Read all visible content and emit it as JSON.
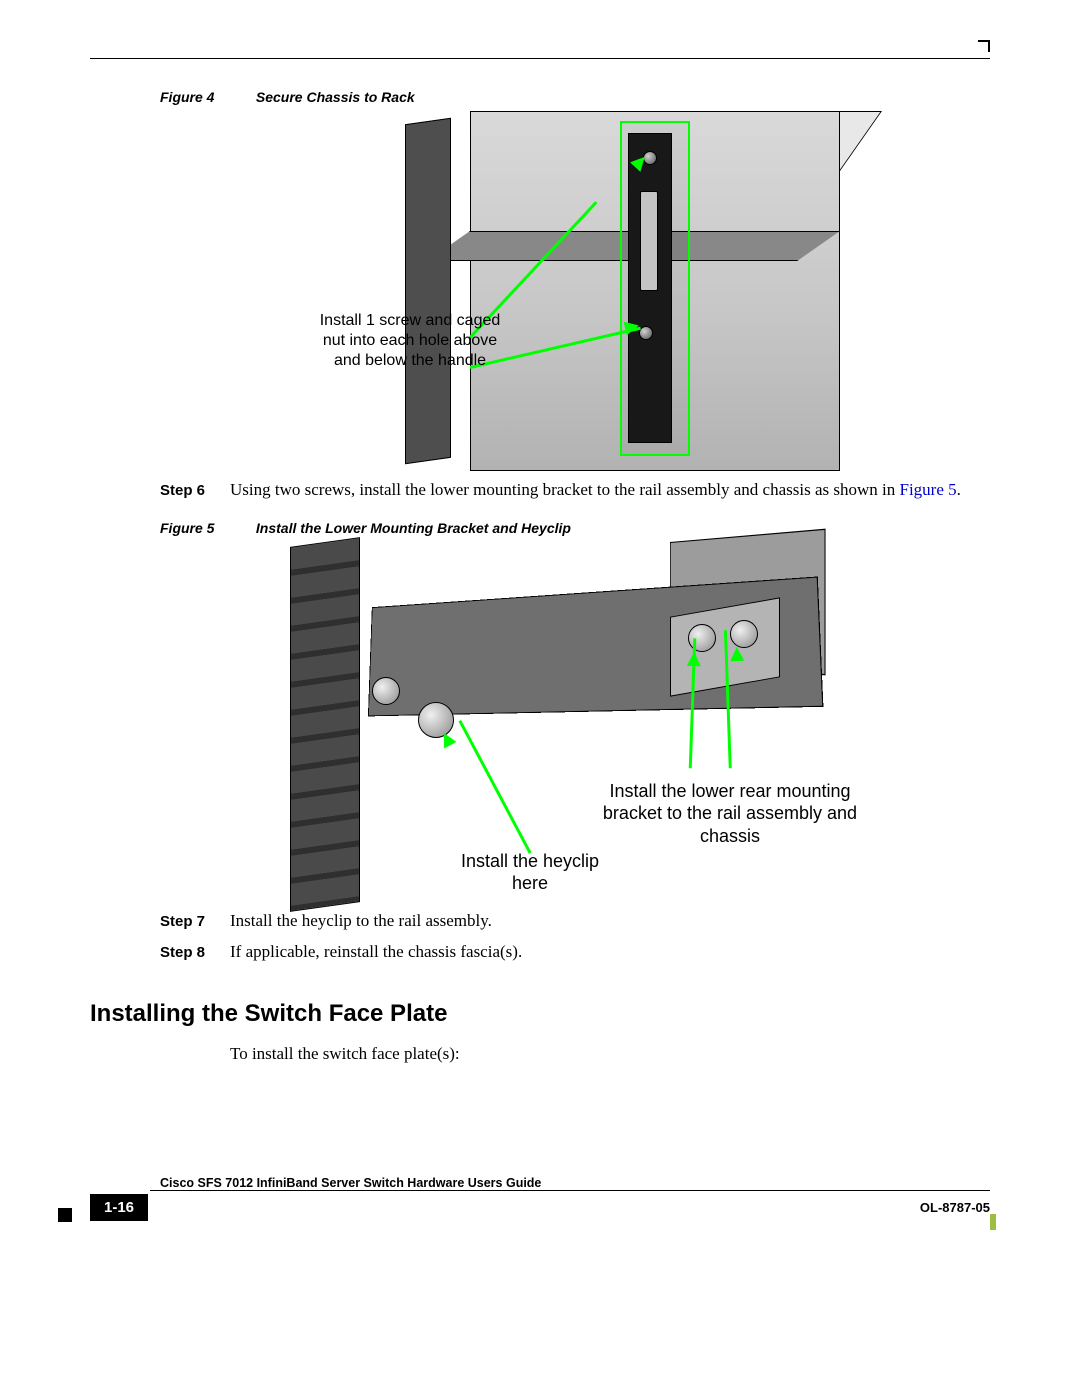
{
  "figure4": {
    "label": "Figure 4",
    "title": "Secure Chassis to Rack",
    "annotation": "Install 1 screw and caged nut into  each hole above and below the handle"
  },
  "steps": {
    "s6_label": "Step 6",
    "s6_text": "Using two screws, install the lower mounting bracket to the rail assembly and chassis as shown in ",
    "s6_link": "Figure 5",
    "s6_tail": ".",
    "s7_label": "Step 7",
    "s7_text": "Install the heyclip to the rail assembly.",
    "s8_label": "Step 8",
    "s8_text": "If applicable, reinstall the chassis fascia(s)."
  },
  "figure5": {
    "label": "Figure 5",
    "title": "Install the Lower Mounting Bracket and Heyclip",
    "annotation_right": "Install the lower rear mounting bracket to the rail assembly and chassis",
    "annotation_bottom": "Install the heyclip  here"
  },
  "heading": "Installing the Switch Face Plate",
  "intro": "To install the switch face plate(s):",
  "footer": {
    "guide": "Cisco SFS 7012 InfiniBand Server Switch Hardware Users Guide",
    "page": "1-16",
    "ol": "OL-8787-05"
  }
}
